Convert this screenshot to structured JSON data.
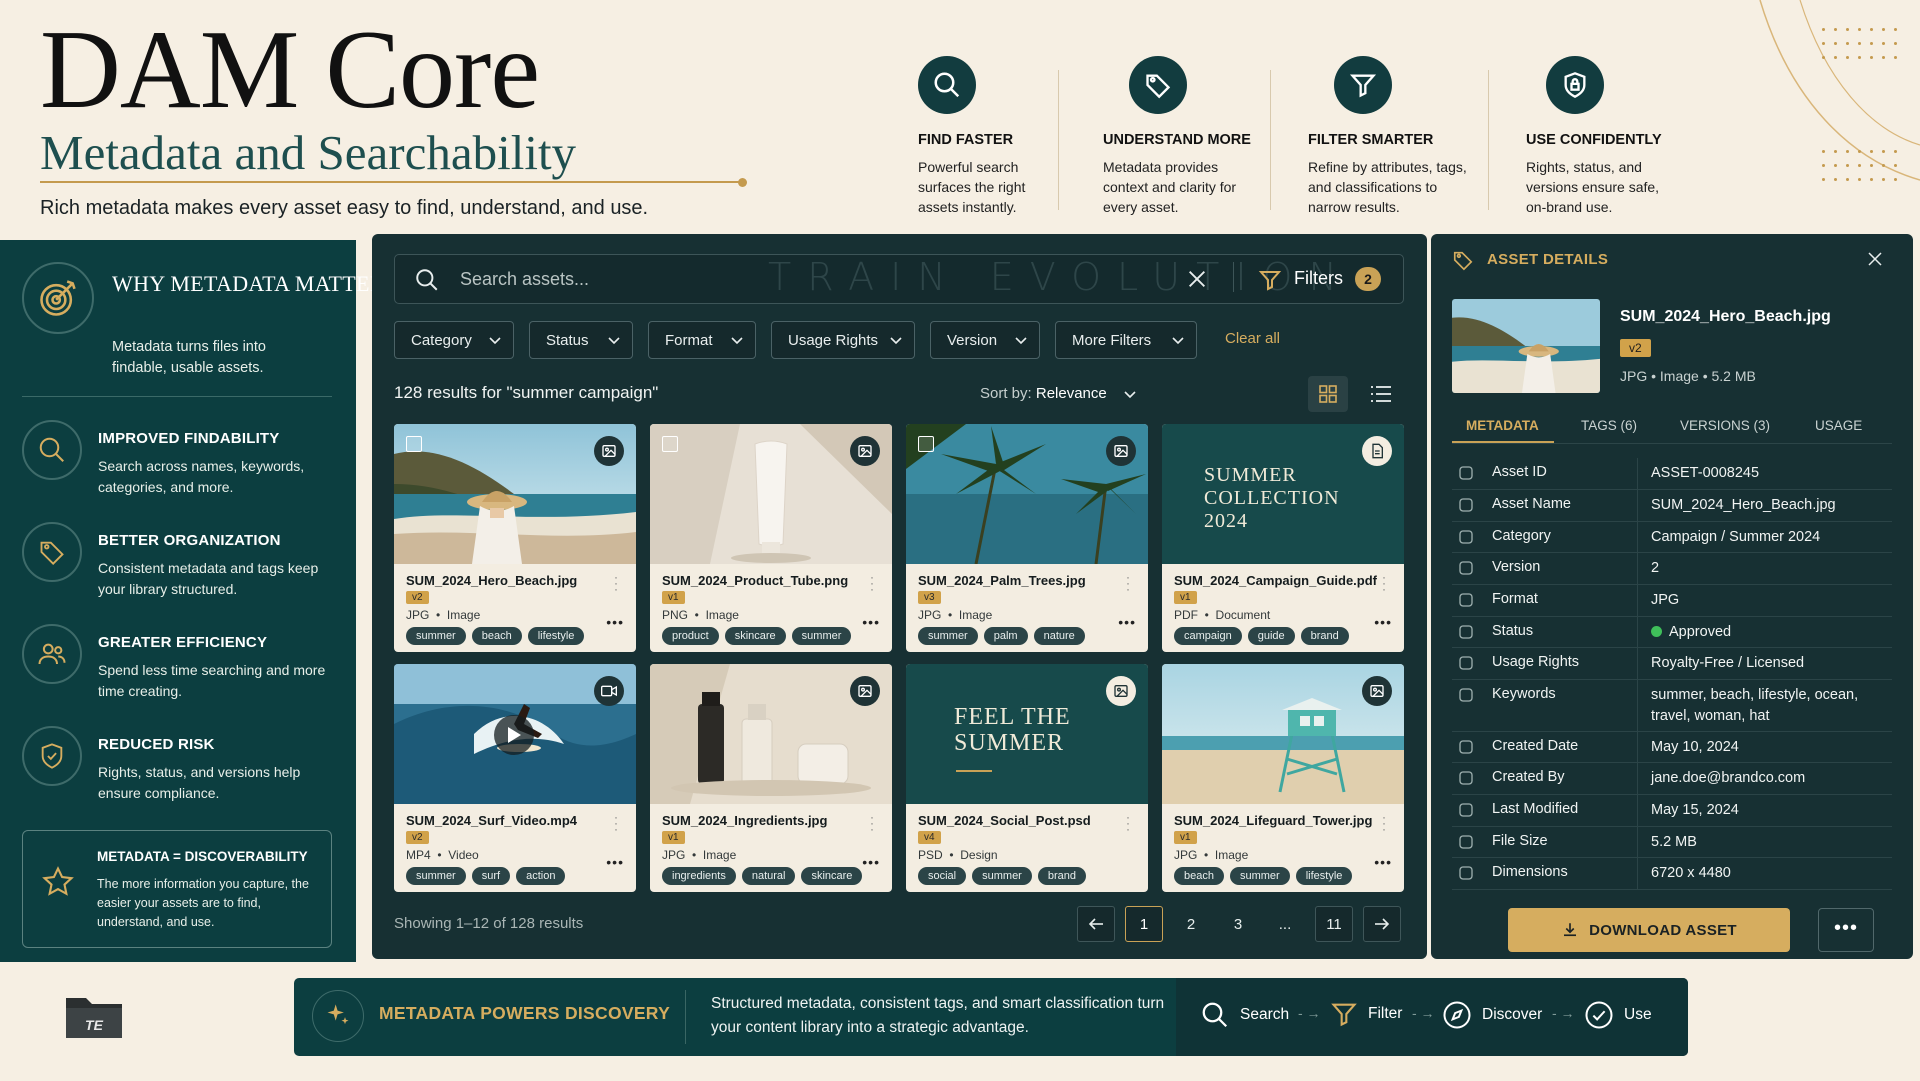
{
  "header": {
    "title": "DAM Core",
    "subtitle": "Metadata and Searchability",
    "tagline": "Rich metadata makes every asset easy to find, understand, and use."
  },
  "features": [
    {
      "icon": "search-icon",
      "title": "FIND FASTER",
      "desc": "Powerful search surfaces the right assets instantly."
    },
    {
      "icon": "tag-icon",
      "title": "UNDERSTAND MORE",
      "desc": "Metadata provides context and clarity for every asset."
    },
    {
      "icon": "funnel-icon",
      "title": "FILTER SMARTER",
      "desc": "Refine by attributes, tags, and classifications to narrow results."
    },
    {
      "icon": "shield-lock-icon",
      "title": "USE CONFIDENTLY",
      "desc": "Rights, status, and versions ensure safe, on-brand use."
    }
  ],
  "sidebar": {
    "title": "WHY METADATA MATTERS",
    "desc": "Metadata turns files into findable, usable assets.",
    "items": [
      {
        "icon": "search-icon",
        "title": "IMPROVED FINDABILITY",
        "desc": "Search across names, keywords, categories, and more."
      },
      {
        "icon": "tag-icon",
        "title": "BETTER ORGANIZATION",
        "desc": "Consistent metadata and tags keep your library structured."
      },
      {
        "icon": "users-icon",
        "title": "GREATER EFFICIENCY",
        "desc": "Spend less time searching and more time creating."
      },
      {
        "icon": "shield-check-icon",
        "title": "REDUCED RISK",
        "desc": "Rights, status, and versions help ensure compliance."
      }
    ],
    "callout": {
      "title": "METADATA = DISCOVERABILITY",
      "desc": "The more information you capture, the easier your assets are to find, understand, and use."
    }
  },
  "search": {
    "placeholder": "Search assets...",
    "watermark": "TRAIN EVOLUTION",
    "filters_label": "Filters",
    "filters_count": "2"
  },
  "filter_chips": [
    "Category",
    "Status",
    "Format",
    "Usage Rights",
    "Version",
    "More Filters"
  ],
  "clear_all": "Clear all",
  "results": {
    "label": "128 results for \"summer campaign\"",
    "sort_label": "Sort by:",
    "sort_value": "Relevance"
  },
  "assets": [
    {
      "name": "SUM_2024_Hero_Beach.jpg",
      "version": "v2",
      "format": "JPG",
      "type": "Image",
      "tags": [
        "summer",
        "beach",
        "lifestyle"
      ],
      "badge": "image-icon"
    },
    {
      "name": "SUM_2024_Product_Tube.png",
      "version": "v1",
      "format": "PNG",
      "type": "Image",
      "tags": [
        "product",
        "skincare",
        "summer"
      ],
      "badge": "image-icon"
    },
    {
      "name": "SUM_2024_Palm_Trees.jpg",
      "version": "v3",
      "format": "JPG",
      "type": "Image",
      "tags": [
        "summer",
        "palm",
        "nature"
      ],
      "badge": "image-icon"
    },
    {
      "name": "SUM_2024_Campaign_Guide.pdf",
      "version": "v1",
      "format": "PDF",
      "type": "Document",
      "tags": [
        "campaign",
        "guide",
        "brand"
      ],
      "badge": "document-icon",
      "cover_text": "SUMMER COLLECTION 2024"
    },
    {
      "name": "SUM_2024_Surf_Video.mp4",
      "version": "v2",
      "format": "MP4",
      "type": "Video",
      "tags": [
        "summer",
        "surf",
        "action"
      ],
      "badge": "video-icon"
    },
    {
      "name": "SUM_2024_Ingredients.jpg",
      "version": "v1",
      "format": "JPG",
      "type": "Image",
      "tags": [
        "ingredients",
        "natural",
        "skincare"
      ],
      "badge": "image-icon"
    },
    {
      "name": "SUM_2024_Social_Post.psd",
      "version": "v4",
      "format": "PSD",
      "type": "Design",
      "tags": [
        "social",
        "summer",
        "brand"
      ],
      "badge": "image-icon",
      "cover_text": "FEEL THE SUMMER"
    },
    {
      "name": "SUM_2024_Lifeguard_Tower.jpg",
      "version": "v1",
      "format": "JPG",
      "type": "Image",
      "tags": [
        "beach",
        "summer",
        "lifestyle"
      ],
      "badge": "image-icon"
    }
  ],
  "pagination": {
    "showing": "Showing 1–12 of 128 results",
    "pages": [
      "1",
      "2",
      "3",
      "...",
      "11"
    ],
    "current": "1"
  },
  "asset_details": {
    "title": "ASSET DETAILS",
    "file_name": "SUM_2024_Hero_Beach.jpg",
    "version": "v2",
    "meta": "JPG  •  Image  •  5.2 MB",
    "tabs": [
      "METADATA",
      "TAGS (6)",
      "VERSIONS (3)",
      "USAGE"
    ],
    "rows": [
      {
        "key": "Asset ID",
        "value": "ASSET-0008245"
      },
      {
        "key": "Asset Name",
        "value": "SUM_2024_Hero_Beach.jpg"
      },
      {
        "key": "Category",
        "value": "Campaign / Summer 2024"
      },
      {
        "key": "Version",
        "value": "2"
      },
      {
        "key": "Format",
        "value": "JPG"
      },
      {
        "key": "Status",
        "value": "Approved"
      },
      {
        "key": "Usage Rights",
        "value": "Royalty-Free / Licensed"
      },
      {
        "key": "Keywords",
        "value": "summer, beach, lifestyle, ocean, travel, woman, hat"
      },
      {
        "key": "Created Date",
        "value": "May 10, 2024"
      },
      {
        "key": "Created By",
        "value": "jane.doe@brandco.com"
      },
      {
        "key": "Last Modified",
        "value": "May 15, 2024"
      },
      {
        "key": "File Size",
        "value": "5.2 MB"
      },
      {
        "key": "Dimensions",
        "value": "6720 x 4480"
      }
    ],
    "download_label": "DOWNLOAD ASSET"
  },
  "bottom_bar": {
    "title": "METADATA POWERS DISCOVERY",
    "desc": "Structured metadata, consistent tags, and smart classification turn your content library into a strategic advantage.",
    "flow": [
      "Search",
      "Filter",
      "Discover",
      "Use"
    ]
  },
  "logo_text": "TE",
  "colors": {
    "background": "#f6efe3",
    "panel": "#0c3e40",
    "dark_panel": "#173033",
    "accent_gold": "#d6ad5f",
    "status_approved": "#3fbf5a"
  }
}
